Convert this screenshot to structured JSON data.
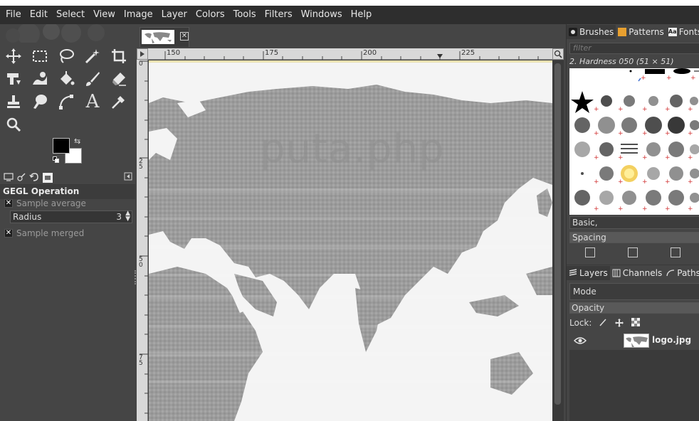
{
  "menu": [
    "File",
    "Edit",
    "Select",
    "View",
    "Image",
    "Layer",
    "Colors",
    "Tools",
    "Filters",
    "Windows",
    "Help"
  ],
  "toolbox": {
    "tool_options_title": "GEGL Operation",
    "sample_average_label": "Sample average",
    "radius_label": "Radius",
    "radius_value": "3",
    "sample_merged_label": "Sample merged",
    "check_mark": "✕"
  },
  "ruler": {
    "h_ticks": [
      "150",
      "175",
      "200",
      "225"
    ],
    "v_ticks": [
      "0",
      "2\n5",
      "5\n0",
      "7\n5"
    ]
  },
  "canvas": {
    "watermark": "puta.php"
  },
  "right_panel": {
    "tabs": [
      "Brushes",
      "Patterns",
      "Fonts"
    ],
    "filter_placeholder": "filter",
    "brush_name": "2. Hardness 050 (51 × 51)",
    "tag_field": "Basic,",
    "spacing_label": "Spacing",
    "layer_tabs": [
      "Layers",
      "Channels",
      "Paths"
    ],
    "mode_label": "Mode",
    "opacity_label": "Opacity",
    "lock_label": "Lock:",
    "layer_name": "logo.jpg"
  },
  "colors": {
    "menubar_bg": "#2e2e2e",
    "panel_bg": "#454545",
    "foreground": "#000000",
    "background": "#ffffff"
  }
}
